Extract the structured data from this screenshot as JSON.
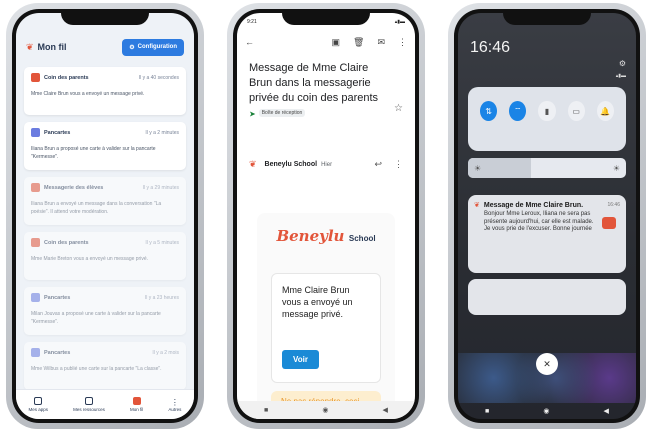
{
  "phone1": {
    "title": "Mon fil",
    "config_button": "Configuration",
    "cards": [
      {
        "title": "Coin des parents",
        "time": "Il y a 40 secondes",
        "body": "Mme Claire Brun vous a envoyé un message privé.",
        "color": "#e2553a"
      },
      {
        "title": "Pancartes",
        "time": "Il y a 2 minutes",
        "body": "Iliana Brun a proposé une carte à valider sur la pancarte \"Kermesse\".",
        "color": "#6b7ce0"
      },
      {
        "title": "Messagerie des élèves",
        "time": "Il y a 29 minutes",
        "body": "Iliana Brun a envoyé un message dans la conversation \"La poésie\". Il attend votre modération.",
        "color": "#e2553a"
      },
      {
        "title": "Coin des parents",
        "time": "Il y a 5 minutes",
        "body": "Mme Marie Breton vous a envoyé un message privé.",
        "color": "#e2553a"
      },
      {
        "title": "Pancartes",
        "time": "Il y a 23 heures",
        "body": "Milan Jouvas a proposé une carte à valider sur la pancarte \"Kermesse\".",
        "color": "#6b7ce0"
      },
      {
        "title": "Pancartes",
        "time": "Il y a 2 mois",
        "body": "Mme Wilbus a publié une carte sur la pancarte \"La classe\".",
        "color": "#6b7ce0"
      }
    ],
    "nav": [
      "Mes apps",
      "Mes ressources",
      "Mon fil",
      "Autres"
    ]
  },
  "phone2": {
    "time": "9:21",
    "subject": "Message de Mme Claire Brun dans la messagerie privée du coin des parents",
    "badge": "Boîte de réception",
    "sender": "Beneylu School",
    "date": "Hier",
    "logo_main": "Beneylu",
    "logo_sub": "School",
    "message": "Mme Claire Brun vous a envoyé un message privé.",
    "button": "Voir",
    "noreply": "Ne pas répondre, ceci"
  },
  "phone3": {
    "clock": "16:46",
    "notif_title": "Message de Mme Claire Brun.",
    "notif_time": "16:46",
    "notif_body": "Bonjour Mme Leroux, Iliana ne sera pas présente aujourd'hui, car elle est malade. Je vous prie de l'excuser. Bonne journée"
  }
}
